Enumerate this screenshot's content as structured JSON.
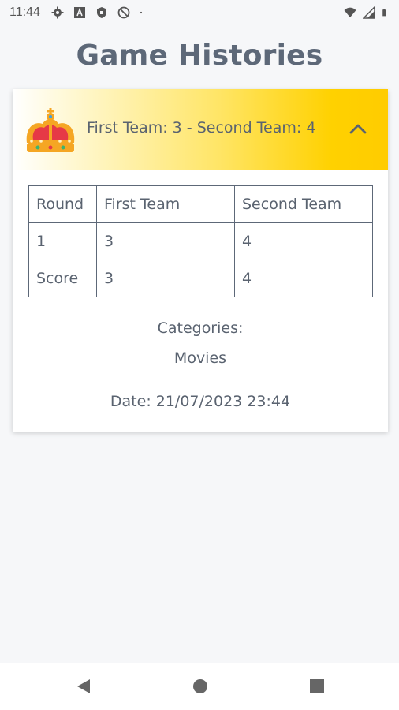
{
  "status_bar": {
    "time": "11:44",
    "left_icons": [
      "gear-icon",
      "font-icon",
      "shield-icon",
      "no-entry-icon",
      "dot-icon"
    ],
    "right_icons": [
      "wifi-icon",
      "signal-icon",
      "battery-icon"
    ]
  },
  "page": {
    "title": "Game Histories"
  },
  "history_card": {
    "header_text": "First Team: 3 - Second Team: 4",
    "header_icon": "crown-icon",
    "toggle_icon": "chevron-up-icon",
    "header_gradient": [
      "#ffffff",
      "#ffcc00"
    ],
    "table": {
      "headers": [
        "Round",
        "First Team",
        "Second Team"
      ],
      "rows": [
        [
          "1",
          "3",
          "4"
        ],
        [
          "Score",
          "3",
          "4"
        ]
      ]
    },
    "categories_label": "Categories:",
    "categories_value": "Movies",
    "date_text": "Date: 21/07/2023 23:44"
  },
  "nav_bar": {
    "buttons": [
      "back-icon",
      "home-icon",
      "recents-icon"
    ]
  },
  "colors": {
    "background": "#f6f7f9",
    "text": "#5a6370",
    "accent": "#ffcc00"
  }
}
